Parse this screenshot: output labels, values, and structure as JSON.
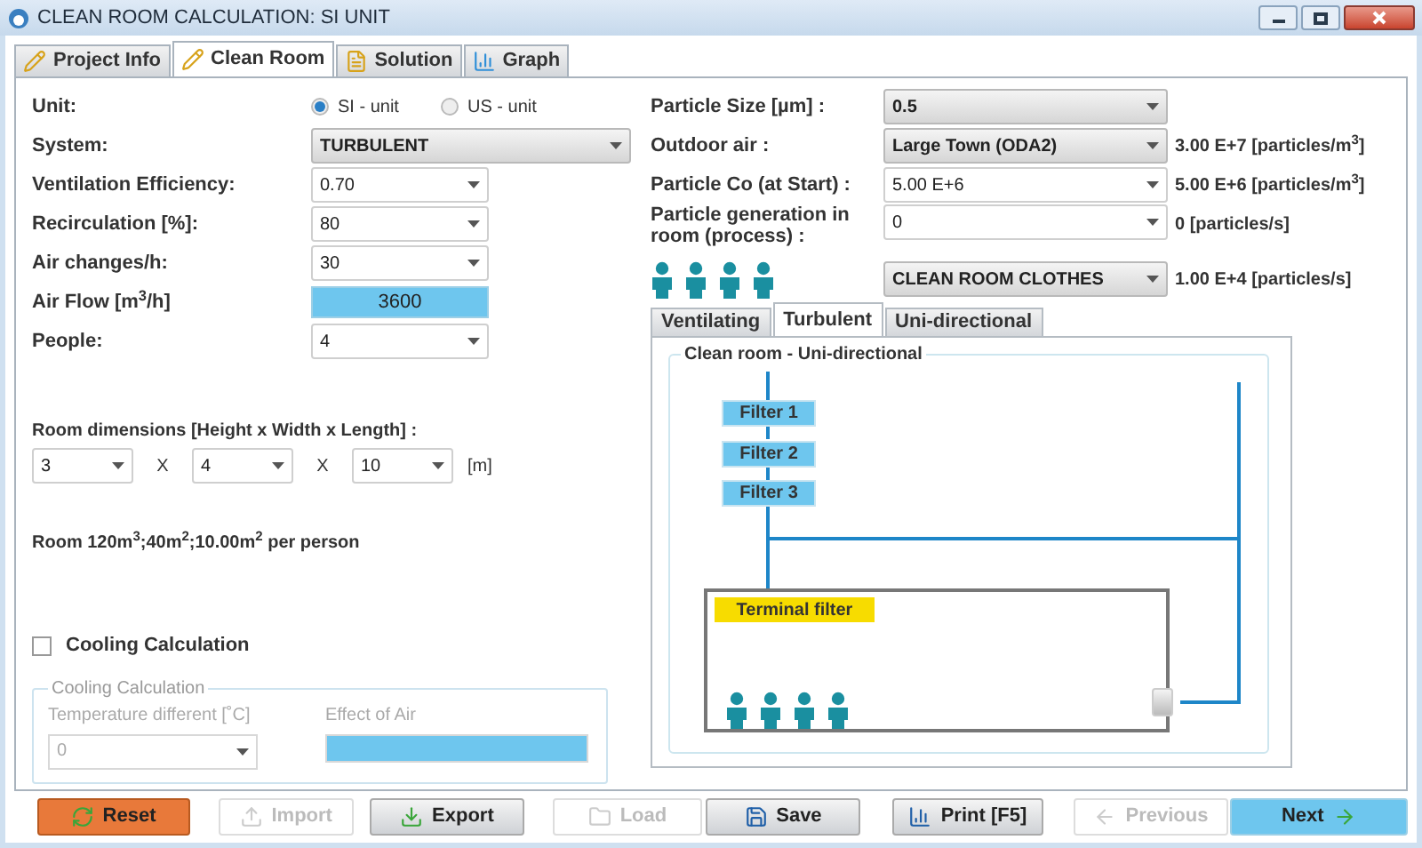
{
  "window": {
    "title": "CLEAN ROOM CALCULATION: SI UNIT"
  },
  "tabs": [
    {
      "label": "Project Info",
      "selected": false
    },
    {
      "label": "Clean Room",
      "selected": true
    },
    {
      "label": "Solution",
      "selected": false
    },
    {
      "label": "Graph",
      "selected": false
    }
  ],
  "unit": {
    "label": "Unit:",
    "options": [
      {
        "label": "SI - unit",
        "selected": true
      },
      {
        "label": "US - unit",
        "selected": false
      }
    ]
  },
  "fields": [
    {
      "label": "System:",
      "kind": "combo",
      "value": "TURBULENT"
    },
    {
      "label": "Ventilation Efficiency:",
      "kind": "editable",
      "value": "0.70"
    },
    {
      "label": "Recirculation [%]:",
      "kind": "editable",
      "value": "80"
    },
    {
      "label": "Air changes/h:",
      "kind": "editable",
      "value": "30"
    },
    {
      "label": "Air Flow [m$^{3}$/h]",
      "kind": "readout",
      "value": "3600"
    },
    {
      "label": "People:",
      "kind": "editable",
      "value": "4"
    }
  ],
  "room_dimensions": {
    "label": "Room dimensions [Height x Width x Length] :",
    "values": [
      "3",
      "4",
      "10"
    ],
    "separators": [
      "X",
      "X"
    ],
    "unit": "[m]"
  },
  "room_summary": "Room 120m$^{3}$;40m$^{2}$;10.00m$^{2}$ per person",
  "cooling": {
    "checkbox": {
      "label": "Cooling Calculation",
      "checked": false
    },
    "group_title": "Cooling Calculation",
    "temperature_label": "Temperature different [˚C]",
    "temperature_value": "0",
    "effect_label": "Effect of Air"
  },
  "particles": [
    {
      "label": "Particle Size [µm] :",
      "kind": "combo",
      "value": "0.5"
    },
    {
      "label": "Outdoor air :",
      "kind": "combo",
      "value": "Large Town (ODA2)",
      "reading": "3.00 E+7 [particles/m$^{3}$]"
    },
    {
      "label": "Particle Co (at Start) :",
      "kind": "editable",
      "value": "5.00 E+6",
      "reading": "5.00 E+6 [particles/m$^{3}$]"
    },
    {
      "label": "Particle generation in room (process) :",
      "kind": "editable",
      "value": "0",
      "reading": "0 [particles/s]"
    }
  ],
  "clothing": {
    "value": "CLEAN ROOM CLOTHES",
    "reading": "1.00 E+4 [particles/s]"
  },
  "diagram_tabs": [
    {
      "label": "Ventilating",
      "selected": false
    },
    {
      "label": "Turbulent",
      "selected": true
    },
    {
      "label": "Uni-directional",
      "selected": false
    }
  ],
  "diagram": {
    "title": "Clean room - Uni-directional",
    "filters": [
      "Filter 1",
      "Filter 2",
      "Filter 3"
    ],
    "terminal_filter": "Terminal filter"
  },
  "buttons": [
    {
      "label": "Reset",
      "kind": "reset",
      "disabled": false
    },
    {
      "label": "Import",
      "kind": "import",
      "disabled": true
    },
    {
      "label": "Export",
      "kind": "export",
      "disabled": false
    },
    {
      "label": "Load",
      "kind": "load",
      "disabled": true
    },
    {
      "label": "Save",
      "kind": "save",
      "disabled": false
    },
    {
      "label": "Print [F5]",
      "kind": "print",
      "disabled": false
    },
    {
      "label": "Previous",
      "kind": "previous",
      "disabled": true
    },
    {
      "label": "Next",
      "kind": "next",
      "disabled": false
    }
  ]
}
